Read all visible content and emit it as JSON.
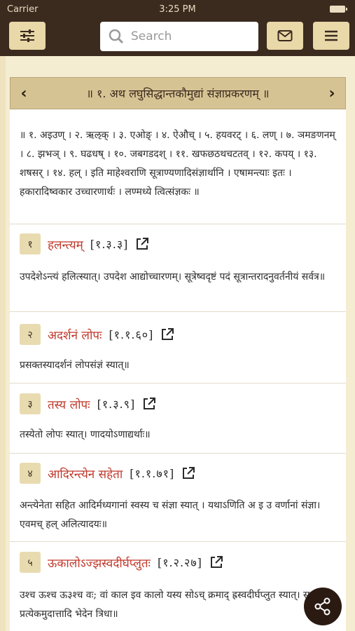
{
  "status": {
    "carrier": "Carrier",
    "time": "3:25 PM"
  },
  "search": {
    "placeholder": "Search"
  },
  "chapter": {
    "title": "॥ १. अथ लघुसिद्धान्तकौमुद्यां संज्ञाप्रकरणम् ॥"
  },
  "intro_text": "॥ १. अइउण् । २. ऋऌक् । ३. एओङ् । ४. ऐऔच् । ५. हयवरट् । ६. लण् । ७. ञमङणनम् । ८. झभञ् । ९. घढधष् । १०. जबगडदश् । ११. खफछठथचटतव् । १२. कपय् । १३. शषसर् । १४. हल् । इति माहेश्वराणि सूत्राण्यणादिसंज्ञार्थानि । एषामन्त्याः इतः । हकारादिष्वकार उच्चारणार्थः । लण्मध्ये त्वित्संज्ञकः ॥",
  "sutras": [
    {
      "num": "१",
      "name": "हलन्त्यम्",
      "ref": "[१.३.३]",
      "text": "उपदेशेऽन्त्यं हलित्स्यात्। उपदेश आद्योच्चारणम्। सूत्रेष्वदृष्टं पदं सूत्रान्तरादनुवर्तनीयं सर्वत्र॥"
    },
    {
      "num": "२",
      "name": "अदर्शनं लोपः",
      "ref": "[१.१.६०]",
      "text": "प्रसक्तस्यादर्शनं लोपसंज्ञं स्यात्॥"
    },
    {
      "num": "३",
      "name": "तस्य लोपः",
      "ref": "[१.३.९]",
      "text": "तस्येतो लोपः स्यात्। णादयोऽणाद्यर्थाः॥"
    },
    {
      "num": "४",
      "name": "आदिरन्त्येन सहेता",
      "ref": "[१.१.७१]",
      "text": "अन्त्येनेता सहित आदिर्मध्यगानां स्वस्य च संज्ञा स्यात् । यथाऽणिति अ इ उ वर्णानां संज्ञा। एवमच् हल् अलित्यादयः॥"
    },
    {
      "num": "५",
      "name": "ऊकालोऽज्झस्वदीर्घप्लुतः",
      "ref": "[१.२.२७]",
      "text": "उश्च ऊश्च ऊ३श्च वः; वां काल इव कालो यस्य सोऽच् क्रमाद् ह्रस्वदीर्घप्लुत स्यात्। स प्रत्येकमुदात्तादि भेदेन त्रिधा॥"
    }
  ]
}
